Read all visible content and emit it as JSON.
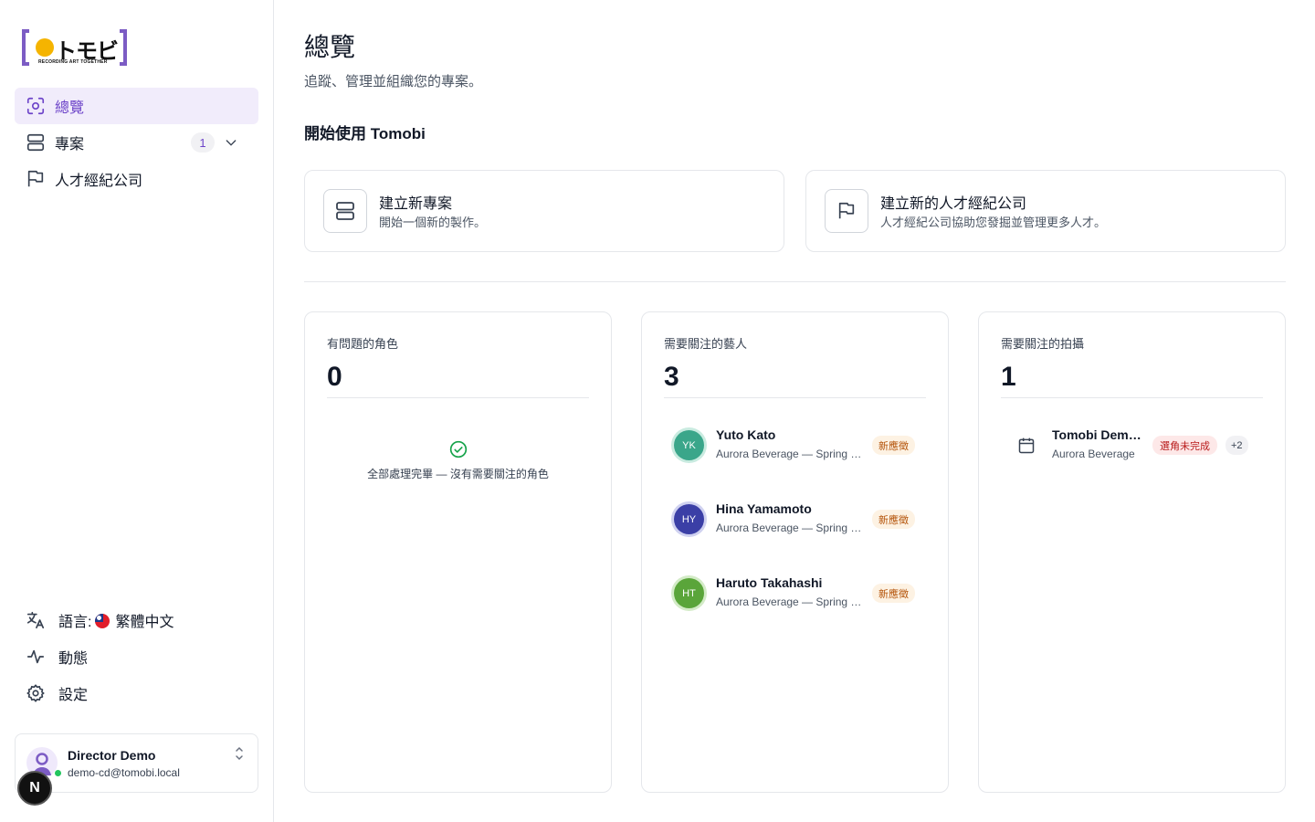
{
  "brand": {
    "name": "トモビ",
    "tagline": "RECORDING ART TOGETHER",
    "accent_color": "#7c5cc4",
    "dot_color": "#f5b400"
  },
  "sidebar": {
    "items": [
      {
        "label": "總覽",
        "icon": "overview-icon",
        "active": true
      },
      {
        "label": "專案",
        "icon": "projects-icon",
        "badge": "1",
        "expand_icon": "chevron-down-icon"
      },
      {
        "label": "人才經紀公司",
        "icon": "flag-icon"
      }
    ],
    "bottom": {
      "language_label": "語言:",
      "language_value": "繁體中文",
      "activity_label": "動態",
      "settings_label": "設定"
    },
    "user": {
      "name": "Director Demo",
      "email": "demo-cd@tomobi.local",
      "status": "online"
    },
    "dev_badge": "N"
  },
  "main": {
    "title": "總覽",
    "subtitle": "追蹤、管理並組織您的專案。",
    "getting_started_title": "開始使用 Tomobi",
    "actions": [
      {
        "title": "建立新專案",
        "subtitle": "開始一個新的製作。",
        "icon": "projects-icon"
      },
      {
        "title": "建立新的人才經紀公司",
        "subtitle": "人才經紀公司協助您發掘並管理更多人才。",
        "icon": "flag-icon"
      }
    ],
    "stats": {
      "roles": {
        "label": "有問題的角色",
        "count": "0",
        "empty_text": "全部處理完畢 — 沒有需要關注的角色"
      },
      "talents": {
        "label": "需要關注的藝人",
        "count": "3",
        "items": [
          {
            "initials": "YK",
            "name": "Yuto Kato",
            "subtitle": "Aurora Beverage — Spring Campaign",
            "status": "新應徵",
            "avatar_color": "#3aa68a"
          },
          {
            "initials": "HY",
            "name": "Hina Yamamoto",
            "subtitle": "Aurora Beverage — Spring Campaign",
            "status": "新應徵",
            "avatar_color": "#3b3fa6"
          },
          {
            "initials": "HT",
            "name": "Haruto Takahashi",
            "subtitle": "Aurora Beverage — Spring Campaign",
            "status": "新應徵",
            "avatar_color": "#5aa53a"
          }
        ]
      },
      "shoots": {
        "label": "需要關注的拍攝",
        "count": "1",
        "items": [
          {
            "name": "Tomobi Demo Shoot",
            "subtitle": "Aurora Beverage",
            "status": "選角未完成",
            "more": "+2",
            "icon": "calendar-icon"
          }
        ]
      }
    }
  }
}
